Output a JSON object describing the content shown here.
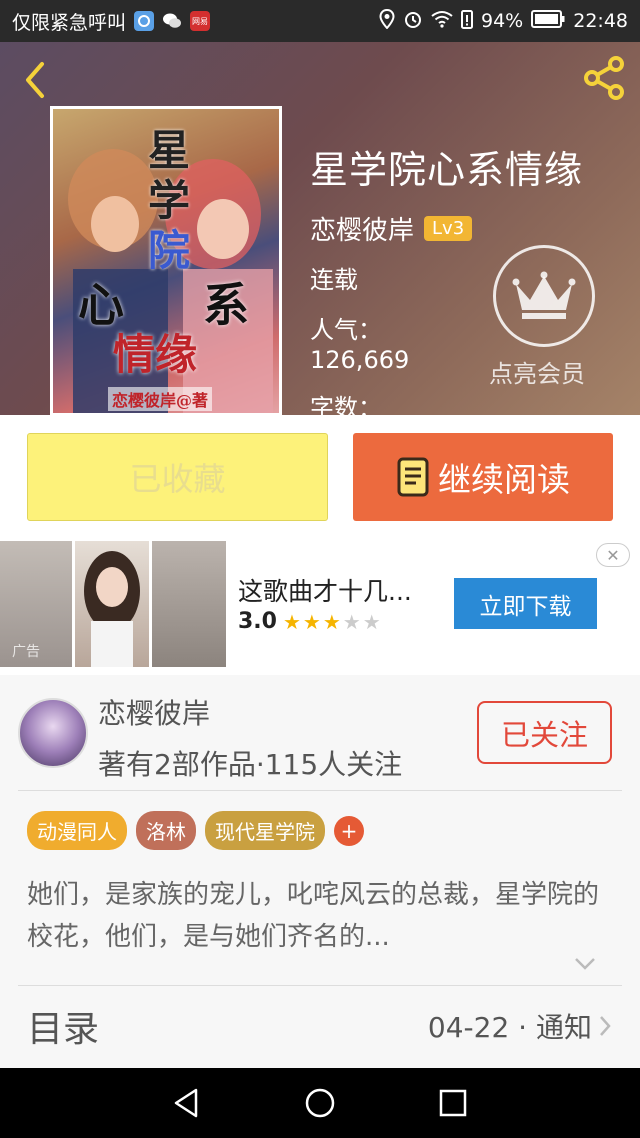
{
  "status_bar": {
    "carrier_text": "仅限紧急呼叫",
    "notif_label": "网易",
    "battery": "94%",
    "time": "22:48"
  },
  "book": {
    "title": "星学院心系情缘",
    "author": "恋樱彼岸",
    "level": "Lv3",
    "status": "连载",
    "popularity_label": "人气：",
    "popularity_value": "126,669",
    "wordcount_label": "字数：",
    "cover_chars": [
      "星",
      "学",
      "院",
      "心",
      "系",
      "情缘"
    ],
    "cover_footer": "恋樱彼岸@著"
  },
  "vip": {
    "label": "点亮会员"
  },
  "actions": {
    "favorite_label": "已收藏",
    "read_label": "继续阅读"
  },
  "ad": {
    "title": "这歌曲才十几...",
    "rating": "3.0",
    "stars_filled": 3,
    "stars_total": 5,
    "download_label": "立即下载",
    "ad_mark": "广告"
  },
  "author_info": {
    "name": "恋樱彼岸",
    "stats": "著有2部作品·115人关注",
    "follow_label": "已关注"
  },
  "tags": [
    "动漫同人",
    "洛林",
    "现代星学院"
  ],
  "tag_add_label": "+",
  "description": "她们，是家族的宠儿，叱咤风云的总裁，星学院的校花，他们，是与她们齐名的...",
  "toc": {
    "label": "目录",
    "latest": "04-22 · 通知"
  },
  "colors": {
    "accent_orange": "#ec6a3e",
    "favorite_yellow": "#fdf27a",
    "follow_red": "#e2483a",
    "level_badge": "#f2b633"
  }
}
